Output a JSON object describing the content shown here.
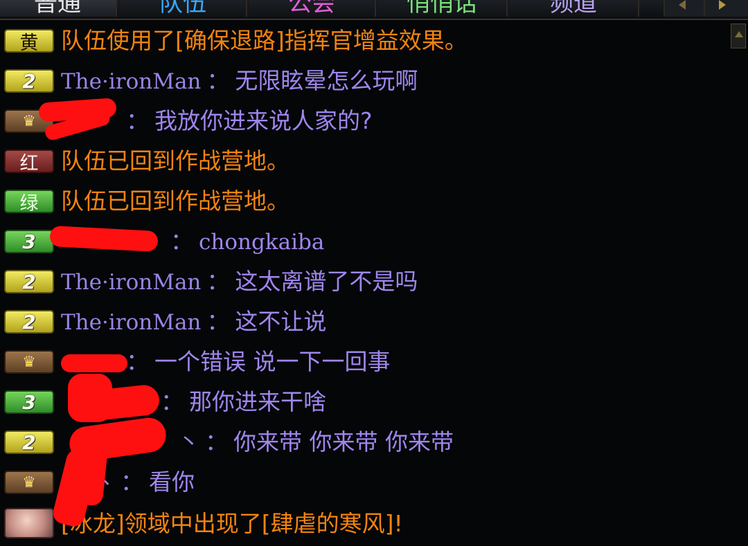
{
  "tabs": [
    {
      "label": "普通",
      "color": "#e8e8e8"
    },
    {
      "label": "队伍",
      "color": "#37a7ff"
    },
    {
      "label": "公会",
      "color": "#e25ed7"
    },
    {
      "label": "悄悄话",
      "color": "#7be17b"
    },
    {
      "label": "频道",
      "color": "#b9a3f0"
    }
  ],
  "chat": {
    "rows": [
      {
        "badge": {
          "type": "yellow",
          "text": "黄"
        },
        "system": "队伍使用了[确保退路]指挥官增益效果。"
      },
      {
        "badge": {
          "type": "yellow",
          "text": "2"
        },
        "name": "The·ironMan",
        "colon": "：",
        "message": "无限眩晕怎么玩啊"
      },
      {
        "badge": {
          "type": "brown",
          "icon": "crown-icon"
        },
        "name": "",
        "colon": "：",
        "message": "我放你进来说人家的?"
      },
      {
        "badge": {
          "type": "red",
          "text": "红"
        },
        "system": "队伍已回到作战营地。"
      },
      {
        "badge": {
          "type": "green",
          "text": "绿"
        },
        "system": "队伍已回到作战营地。"
      },
      {
        "badge": {
          "type": "green",
          "text": "3"
        },
        "name": "",
        "colon": "：",
        "message": "chongkaiba"
      },
      {
        "badge": {
          "type": "yellow",
          "text": "2"
        },
        "name": "The·ironMan",
        "colon": "：",
        "message": "这太离谱了不是吗"
      },
      {
        "badge": {
          "type": "yellow",
          "text": "2"
        },
        "name": "The·ironMan",
        "colon": "：",
        "message": "这不让说"
      },
      {
        "badge": {
          "type": "brown",
          "icon": "crown-icon"
        },
        "name": "",
        "colon": "：",
        "message": "一个错误 说一下一回事"
      },
      {
        "badge": {
          "type": "green",
          "text": "3"
        },
        "name": "",
        "colon": "：",
        "message": "那你进来干啥"
      },
      {
        "badge": {
          "type": "yellow",
          "text": "2"
        },
        "name": "丶",
        "colon": "：",
        "message": "你来带 你来带 你来带"
      },
      {
        "badge": {
          "type": "brown",
          "icon": "crown-icon"
        },
        "name": "丶",
        "colon": "：",
        "message": "看你"
      },
      {
        "badge": {
          "type": "avatar",
          "icon": "avatar-icon"
        },
        "system": "[冰龙]领域中出现了[肆虐的寒风]!"
      }
    ]
  },
  "colors": {
    "system_text": "#f2840f",
    "player_name": "#9a84e4",
    "player_message": "#9f86ee",
    "redaction": "#ff1010"
  }
}
